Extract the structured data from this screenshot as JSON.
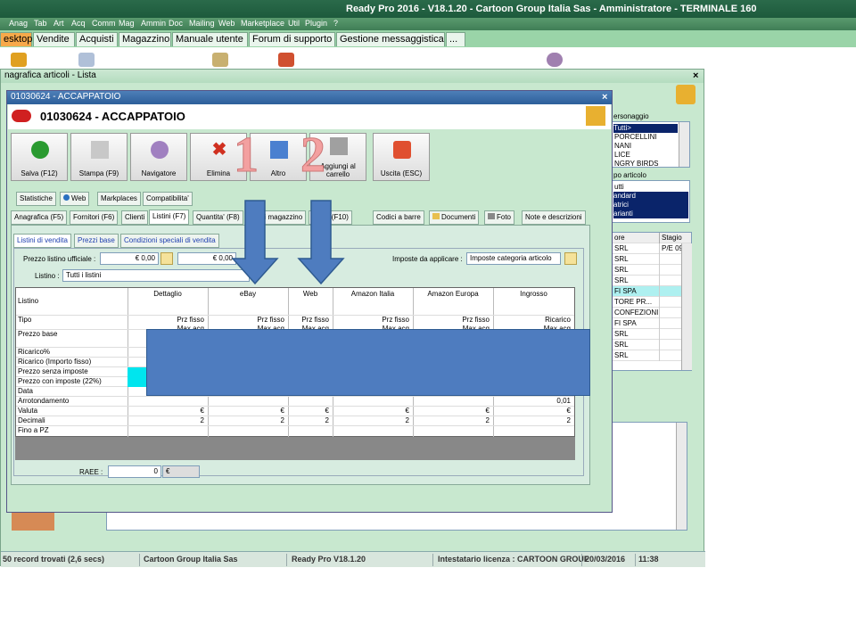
{
  "window": {
    "title": "Ready Pro 2016 - V18.1.20 - Cartoon Group Italia Sas - Amministratore - TERMINALE 160"
  },
  "menu": [
    {
      "label": "Anag"
    },
    {
      "label": "Tab"
    },
    {
      "label": "Art"
    },
    {
      "label": "Acq"
    },
    {
      "label": "Comm"
    },
    {
      "label": "Mag"
    },
    {
      "label": "Ammin"
    },
    {
      "label": "Doc"
    },
    {
      "label": "Mailing"
    },
    {
      "label": "Web"
    },
    {
      "label": "Marketplace"
    },
    {
      "label": "Util"
    },
    {
      "label": "Plugin"
    },
    {
      "label": "?"
    }
  ],
  "main_tabs": [
    {
      "label": "esktop"
    },
    {
      "label": "Vendite"
    },
    {
      "label": "Acquisti"
    },
    {
      "label": "Magazzino"
    },
    {
      "label": "Manuale utente"
    },
    {
      "label": "Forum di supporto"
    },
    {
      "label": "Gestione messaggistica"
    },
    {
      "label": "..."
    }
  ],
  "list_window": {
    "title": "nagrafica articoli - Lista"
  },
  "article_window": {
    "title": "01030624 - ACCAPPATOIO",
    "header": "01030624 - ACCAPPATOIO",
    "buttons": [
      {
        "label": "Salva (F12)"
      },
      {
        "label": "Stampa (F9)"
      },
      {
        "label": "Navigatore"
      },
      {
        "label": "Elimina"
      },
      {
        "label": "Altro"
      },
      {
        "label": "Aggiungi al carrello"
      },
      {
        "label": "Uscita (ESC)"
      }
    ],
    "tabs_row1": [
      {
        "label": "Statistiche"
      },
      {
        "label": "Web"
      },
      {
        "label": "Markplaces"
      },
      {
        "label": "Compatibilita'"
      }
    ],
    "tabs_row2": [
      {
        "label": "Anagrafica (F5)"
      },
      {
        "label": "Fornitori (F6)"
      },
      {
        "label": "Clienti"
      },
      {
        "label": "Listini (F7)"
      },
      {
        "label": "Quantita' (F8)"
      },
      {
        "label": "di magazzino"
      },
      {
        "label": "menti (F10)"
      },
      {
        "label": "Codici a barre"
      },
      {
        "label": "Documenti"
      },
      {
        "label": "Foto"
      },
      {
        "label": "Note e descrizioni"
      }
    ],
    "sub_tabs": [
      {
        "label": "Listini di vendita"
      },
      {
        "label": "Prezzi base"
      },
      {
        "label": "Condizioni speciali di vendita"
      }
    ],
    "prezzo_label": "Prezzo listino ufficiale :",
    "prezzo_value_1": "€ 0,00",
    "prezzo_value_2": "€ 0,00",
    "imposte_label": "Imposte da applicare :",
    "imposte_value": "Imposte categoria articolo",
    "listino_label": "Listino :",
    "listino_value": "Tutti i listini",
    "grid": {
      "corner": "Listino",
      "columns": [
        "Dettaglio",
        "eBay",
        "Web",
        "Amazon Italia",
        "Amazon Europa",
        "Ingrosso"
      ],
      "rows": [
        "Tipo",
        "Prezzo base",
        "Ricarico%",
        "Ricarico (Importo fisso)",
        "Prezzo senza imposte",
        "Prezzo con imposte (22%)",
        "Data",
        "Arrotondamento",
        "Valuta",
        "Decimali",
        "Fino a PZ"
      ],
      "tipo": [
        "Prz fisso",
        "Prz fisso",
        "Prz fisso",
        "Prz fisso",
        "Prz fisso",
        "Ricarico"
      ],
      "base_partial": [
        "Max acq",
        "Max acq",
        "Max acq",
        "Max acq",
        "Max acq",
        "Max acq"
      ],
      "arrotondamento_last": "0,01",
      "valuta": [
        "€",
        "€",
        "€",
        "€",
        "€",
        "€"
      ],
      "decimali": [
        "2",
        "2",
        "2",
        "2",
        "2",
        "2"
      ]
    },
    "raee_label": "RAEE :",
    "raee_value": "0",
    "raee_currency": "€"
  },
  "right_panel": {
    "personaggio_label": "ersonaggio",
    "personaggio_items": [
      "Tutti>",
      "PORCELLINI",
      "NANI",
      "LICE",
      "NGRY BIRDS"
    ],
    "tipo_label": "po articolo",
    "tipo_items": [
      "utti",
      "andard",
      "atrici",
      "arianti"
    ],
    "table_headers": [
      "ore",
      "Stagio"
    ],
    "table_rows": [
      [
        "SRL",
        "P/E 09"
      ],
      [
        "SRL",
        ""
      ],
      [
        "SRL",
        ""
      ],
      [
        "SRL",
        ""
      ],
      [
        "FI SPA",
        ""
      ],
      [
        "TORE PR...",
        ""
      ],
      [
        "CONFEZIONI",
        ""
      ],
      [
        "FI SPA",
        ""
      ],
      [
        "SRL",
        ""
      ],
      [
        "SRL",
        ""
      ],
      [
        "SRL",
        ""
      ]
    ]
  },
  "status": {
    "records": "50 record trovati (2,6 secs)",
    "company": "Cartoon Group Italia Sas",
    "version": "Ready Pro V18.1.20",
    "license": "Intestatario licenza : CARTOON GROUF",
    "date": "20/03/2016",
    "time": "11:38"
  },
  "annotations": {
    "n1": "1",
    "n2": "2"
  },
  "colors": {
    "accent_orange": "#f7a94a",
    "title_blue": "#2d5f9a",
    "overlay_blue": "#4e7cbf",
    "green_bg": "#c8e8cf"
  }
}
